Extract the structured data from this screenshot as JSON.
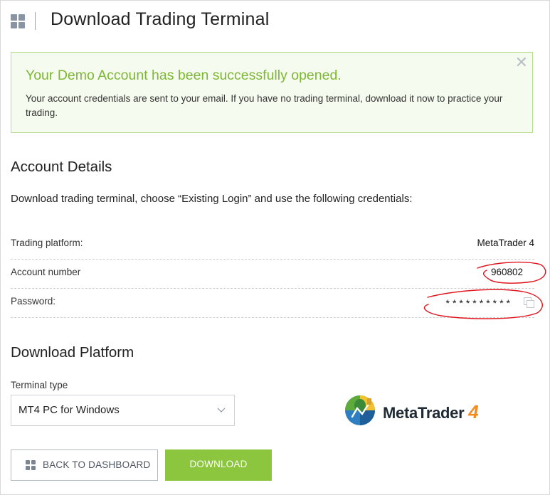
{
  "header": {
    "title": "Download Trading Terminal",
    "menu_icon": "grid-icon"
  },
  "alert": {
    "title": "Your Demo Account has been successfully opened.",
    "body": "Your account credentials are sent to your email. If you have no trading terminal, download it now to practice your trading.",
    "close_icon": "close-icon",
    "accent_color": "#7fb635"
  },
  "account": {
    "section_title": "Account Details",
    "instructions": "Download trading terminal, choose “Existing Login” and use the following credentials:",
    "rows": [
      {
        "label": "Trading platform:",
        "value": "MetaTrader 4"
      },
      {
        "label": "Account number",
        "value": "960802"
      },
      {
        "label": "Password:",
        "value": "**********"
      }
    ],
    "copy_icon": "copy-icon",
    "annotation_color": "#e0141e"
  },
  "download": {
    "section_title": "Download Platform",
    "terminal_label": "Terminal type",
    "terminal_selected": "MT4 PC for Windows",
    "logo_text": "MetaTrader",
    "logo_number": "4"
  },
  "buttons": {
    "back_label": "BACK TO DASHBOARD",
    "download_label": "DOWNLOAD",
    "download_color": "#8cc63f"
  }
}
